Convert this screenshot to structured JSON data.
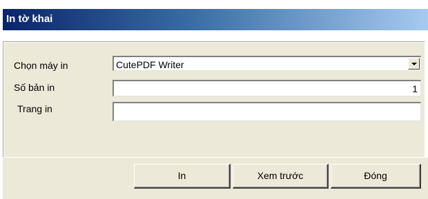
{
  "window": {
    "title": "In tờ khai"
  },
  "form": {
    "printer": {
      "label": "Chọn máy in",
      "value": "CutePDF Writer"
    },
    "copies": {
      "label": "Số bản in",
      "value": "1"
    },
    "pages": {
      "label": "Trang in",
      "value": ""
    }
  },
  "buttons": {
    "print": "In",
    "preview": "Xem trước",
    "close": "Đóng"
  }
}
